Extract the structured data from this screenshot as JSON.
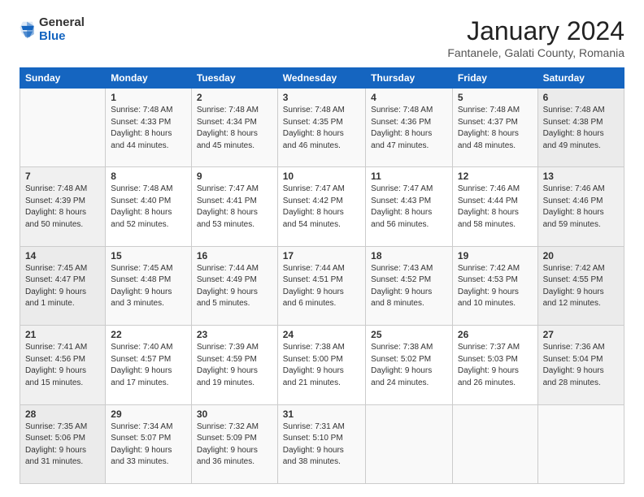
{
  "logo": {
    "general": "General",
    "blue": "Blue"
  },
  "title": "January 2024",
  "location": "Fantanele, Galati County, Romania",
  "days_header": [
    "Sunday",
    "Monday",
    "Tuesday",
    "Wednesday",
    "Thursday",
    "Friday",
    "Saturday"
  ],
  "weeks": [
    [
      {
        "day": "",
        "info": ""
      },
      {
        "day": "1",
        "info": "Sunrise: 7:48 AM\nSunset: 4:33 PM\nDaylight: 8 hours\nand 44 minutes."
      },
      {
        "day": "2",
        "info": "Sunrise: 7:48 AM\nSunset: 4:34 PM\nDaylight: 8 hours\nand 45 minutes."
      },
      {
        "day": "3",
        "info": "Sunrise: 7:48 AM\nSunset: 4:35 PM\nDaylight: 8 hours\nand 46 minutes."
      },
      {
        "day": "4",
        "info": "Sunrise: 7:48 AM\nSunset: 4:36 PM\nDaylight: 8 hours\nand 47 minutes."
      },
      {
        "day": "5",
        "info": "Sunrise: 7:48 AM\nSunset: 4:37 PM\nDaylight: 8 hours\nand 48 minutes."
      },
      {
        "day": "6",
        "info": "Sunrise: 7:48 AM\nSunset: 4:38 PM\nDaylight: 8 hours\nand 49 minutes."
      }
    ],
    [
      {
        "day": "7",
        "info": "Sunrise: 7:48 AM\nSunset: 4:39 PM\nDaylight: 8 hours\nand 50 minutes."
      },
      {
        "day": "8",
        "info": "Sunrise: 7:48 AM\nSunset: 4:40 PM\nDaylight: 8 hours\nand 52 minutes."
      },
      {
        "day": "9",
        "info": "Sunrise: 7:47 AM\nSunset: 4:41 PM\nDaylight: 8 hours\nand 53 minutes."
      },
      {
        "day": "10",
        "info": "Sunrise: 7:47 AM\nSunset: 4:42 PM\nDaylight: 8 hours\nand 54 minutes."
      },
      {
        "day": "11",
        "info": "Sunrise: 7:47 AM\nSunset: 4:43 PM\nDaylight: 8 hours\nand 56 minutes."
      },
      {
        "day": "12",
        "info": "Sunrise: 7:46 AM\nSunset: 4:44 PM\nDaylight: 8 hours\nand 58 minutes."
      },
      {
        "day": "13",
        "info": "Sunrise: 7:46 AM\nSunset: 4:46 PM\nDaylight: 8 hours\nand 59 minutes."
      }
    ],
    [
      {
        "day": "14",
        "info": "Sunrise: 7:45 AM\nSunset: 4:47 PM\nDaylight: 9 hours\nand 1 minute."
      },
      {
        "day": "15",
        "info": "Sunrise: 7:45 AM\nSunset: 4:48 PM\nDaylight: 9 hours\nand 3 minutes."
      },
      {
        "day": "16",
        "info": "Sunrise: 7:44 AM\nSunset: 4:49 PM\nDaylight: 9 hours\nand 5 minutes."
      },
      {
        "day": "17",
        "info": "Sunrise: 7:44 AM\nSunset: 4:51 PM\nDaylight: 9 hours\nand 6 minutes."
      },
      {
        "day": "18",
        "info": "Sunrise: 7:43 AM\nSunset: 4:52 PM\nDaylight: 9 hours\nand 8 minutes."
      },
      {
        "day": "19",
        "info": "Sunrise: 7:42 AM\nSunset: 4:53 PM\nDaylight: 9 hours\nand 10 minutes."
      },
      {
        "day": "20",
        "info": "Sunrise: 7:42 AM\nSunset: 4:55 PM\nDaylight: 9 hours\nand 12 minutes."
      }
    ],
    [
      {
        "day": "21",
        "info": "Sunrise: 7:41 AM\nSunset: 4:56 PM\nDaylight: 9 hours\nand 15 minutes."
      },
      {
        "day": "22",
        "info": "Sunrise: 7:40 AM\nSunset: 4:57 PM\nDaylight: 9 hours\nand 17 minutes."
      },
      {
        "day": "23",
        "info": "Sunrise: 7:39 AM\nSunset: 4:59 PM\nDaylight: 9 hours\nand 19 minutes."
      },
      {
        "day": "24",
        "info": "Sunrise: 7:38 AM\nSunset: 5:00 PM\nDaylight: 9 hours\nand 21 minutes."
      },
      {
        "day": "25",
        "info": "Sunrise: 7:38 AM\nSunset: 5:02 PM\nDaylight: 9 hours\nand 24 minutes."
      },
      {
        "day": "26",
        "info": "Sunrise: 7:37 AM\nSunset: 5:03 PM\nDaylight: 9 hours\nand 26 minutes."
      },
      {
        "day": "27",
        "info": "Sunrise: 7:36 AM\nSunset: 5:04 PM\nDaylight: 9 hours\nand 28 minutes."
      }
    ],
    [
      {
        "day": "28",
        "info": "Sunrise: 7:35 AM\nSunset: 5:06 PM\nDaylight: 9 hours\nand 31 minutes."
      },
      {
        "day": "29",
        "info": "Sunrise: 7:34 AM\nSunset: 5:07 PM\nDaylight: 9 hours\nand 33 minutes."
      },
      {
        "day": "30",
        "info": "Sunrise: 7:32 AM\nSunset: 5:09 PM\nDaylight: 9 hours\nand 36 minutes."
      },
      {
        "day": "31",
        "info": "Sunrise: 7:31 AM\nSunset: 5:10 PM\nDaylight: 9 hours\nand 38 minutes."
      },
      {
        "day": "",
        "info": ""
      },
      {
        "day": "",
        "info": ""
      },
      {
        "day": "",
        "info": ""
      }
    ]
  ]
}
